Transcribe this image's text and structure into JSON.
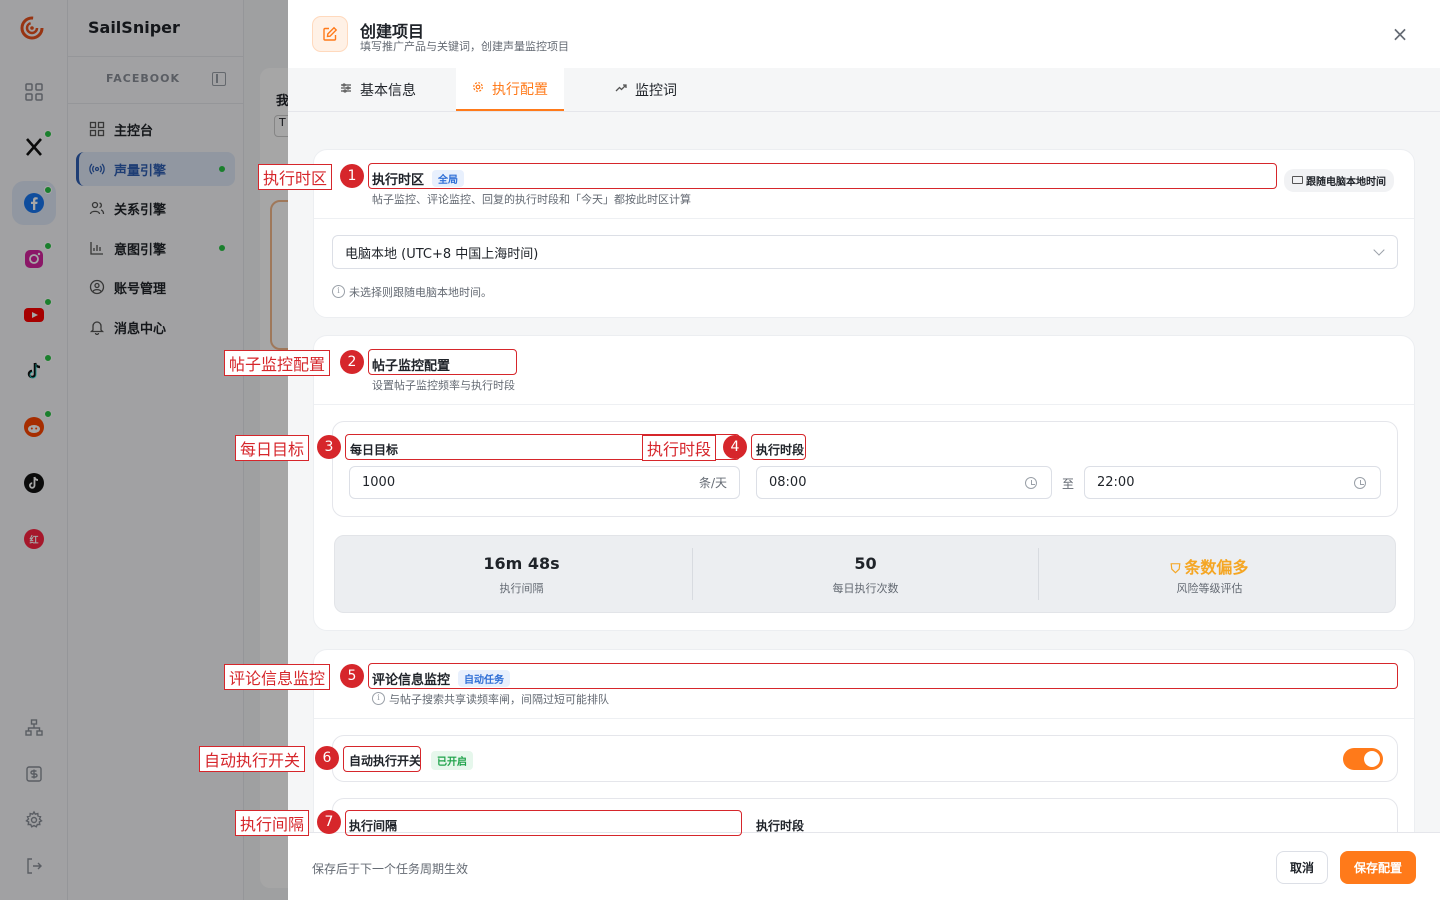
{
  "app": {
    "brand": "SailSniper"
  },
  "rail": {
    "items": [
      {
        "name": "apps-grid-icon",
        "dot": false
      },
      {
        "name": "x-icon",
        "dot": true
      },
      {
        "name": "facebook-icon",
        "dot": true,
        "active": true
      },
      {
        "name": "instagram-icon",
        "dot": true
      },
      {
        "name": "youtube-icon",
        "dot": true
      },
      {
        "name": "tiktok-icon",
        "dot": true
      },
      {
        "name": "reddit-icon",
        "dot": true
      },
      {
        "name": "tiktok-alt-icon",
        "dot": false
      },
      {
        "name": "xiaohongshu-icon",
        "dot": false
      }
    ],
    "bottom": [
      "org-icon",
      "billing-icon",
      "settings-icon",
      "logout-icon"
    ],
    "xiaohongshu_glyph": "红"
  },
  "sidebar": {
    "section": "FACEBOOK",
    "items": [
      {
        "label": "主控台"
      },
      {
        "label": "声量引擎"
      },
      {
        "label": "关系引擎"
      },
      {
        "label": "意图引擎"
      },
      {
        "label": "账号管理"
      },
      {
        "label": "消息中心"
      }
    ]
  },
  "background": {
    "text1": "我",
    "text2": "T"
  },
  "modal": {
    "title": "创建项目",
    "subtitle": "填写推广产品与关键词，创建声量监控项目",
    "tabs": [
      {
        "label": "基本信息"
      },
      {
        "label": "执行配置"
      },
      {
        "label": "监控词"
      }
    ],
    "timezone": {
      "title": "执行时区",
      "badge": "全局",
      "desc": "帖子监控、评论监控、回复的执行时段和「今天」都按此时区计算",
      "follow_btn": "跟随电脑本地时间",
      "select_value": "电脑本地 (UTC+8 中国上海时间)",
      "hint": "未选择则跟随电脑本地时间。"
    },
    "post_monitor": {
      "title": "帖子监控配置",
      "desc": "设置帖子监控频率与执行时段",
      "daily_target_label": "每日目标",
      "daily_target_value": "1000",
      "daily_target_unit": "条/天",
      "period_label": "执行时段",
      "start": "08:00",
      "to": "至",
      "end": "22:00",
      "stats": [
        {
          "value": "16m 48s",
          "label": "执行间隔"
        },
        {
          "value": "50",
          "label": "每日执行次数"
        },
        {
          "value": "条数偏多",
          "label": "风险等级评估"
        }
      ]
    },
    "comment_monitor": {
      "title": "评论信息监控",
      "badge": "自动任务",
      "desc": "与帖子搜索共享读频率闸，间隔过短可能排队",
      "auto_switch_label": "自动执行开关",
      "auto_switch_status": "已开启",
      "auto_switch_on": true,
      "interval_label": "执行间隔",
      "period_label": "执行时段"
    },
    "footer": {
      "note": "保存后于下一个任务周期生效",
      "cancel": "取消",
      "save": "保存配置"
    }
  },
  "annotations": [
    {
      "num": "1",
      "label": "执行时区"
    },
    {
      "num": "2",
      "label": "帖子监控配置"
    },
    {
      "num": "3",
      "label": "每日目标"
    },
    {
      "num": "4",
      "label": "执行时段"
    },
    {
      "num": "5",
      "label": "评论信息监控"
    },
    {
      "num": "6",
      "label": "自动执行开关"
    },
    {
      "num": "7",
      "label": "执行间隔"
    }
  ],
  "colors": {
    "accent": "#ff7a1a",
    "annotation": "#d6262b",
    "active_nav": "#2f5fb3",
    "status_green": "#28c445"
  }
}
